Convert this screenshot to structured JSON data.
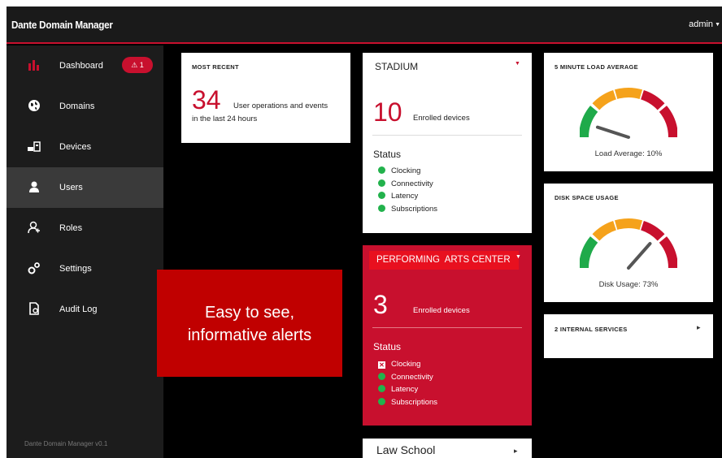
{
  "app": {
    "title": "Dante Domain Manager",
    "user": "admin",
    "version": "Dante Domain Manager v0.1"
  },
  "sidebar": {
    "items": [
      {
        "label": "Dashboard",
        "icon": "bar-chart-icon"
      },
      {
        "label": "Domains",
        "icon": "globe-icon"
      },
      {
        "label": "Devices",
        "icon": "devices-icon"
      },
      {
        "label": "Users",
        "icon": "user-icon"
      },
      {
        "label": "Roles",
        "icon": "roles-icon"
      },
      {
        "label": "Settings",
        "icon": "gears-icon"
      },
      {
        "label": "Audit Log",
        "icon": "audit-log-icon"
      }
    ],
    "active": "Users",
    "alert_count": "1"
  },
  "most_recent": {
    "header": "MOST RECENT",
    "count": "34",
    "text_a": "User operations and events",
    "text_b": "in the last 24 hours"
  },
  "stadium": {
    "name": "STADIUM",
    "count": "10",
    "enrolled_label": "Enrolled devices",
    "status_label": "Status",
    "statuses": [
      "Clocking",
      "Connectivity",
      "Latency",
      "Subscriptions"
    ]
  },
  "pac": {
    "name": "PERFORMING  ARTS CENTER",
    "count": "3",
    "enrolled_label": "Enrolled devices",
    "status_label": "Status",
    "statuses": [
      "Clocking",
      "Connectivity",
      "Latency",
      "Subscriptions"
    ],
    "status_states": [
      "error",
      "ok",
      "ok",
      "ok"
    ]
  },
  "law_school": {
    "name": "Law School"
  },
  "load_average": {
    "header": "5 MINUTE LOAD AVERAGE",
    "caption": "Load Average: 10%",
    "value": 0.1
  },
  "disk_space": {
    "header": "DISK SPACE USAGE",
    "caption": "Disk Usage: 73%",
    "value": 0.73
  },
  "internal_services": {
    "header": "2 INTERNAL SERVICES"
  },
  "overlay": {
    "line1": "Easy to see,",
    "line2": "informative alerts"
  },
  "colors": {
    "accent": "#c8102e",
    "ok": "#22b24c",
    "gauge_green": "#1faa4a",
    "gauge_orange": "#f5a21b",
    "gauge_red": "#c8102e"
  }
}
